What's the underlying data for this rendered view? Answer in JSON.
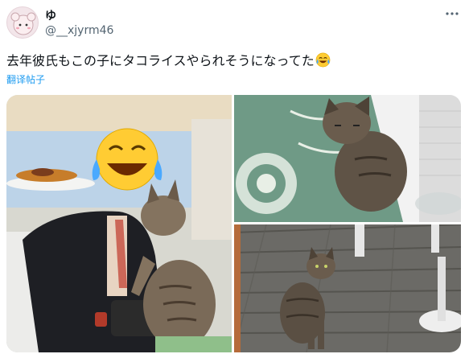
{
  "tweet": {
    "display_name": "ゆ",
    "handle": "@__xjyrm46",
    "text": "去年彼氏もこの子にタコライスやられそうになってた",
    "translate_label": "翻译帖子",
    "emoji_icon": "face-with-tears-of-joy-icon",
    "more_icon": "more-horizontal-icon"
  },
  "colors": {
    "link": "#1d9bf0",
    "secondary_text": "#536471",
    "primary_text": "#0f1419"
  },
  "media": {
    "photo_count": 3
  }
}
